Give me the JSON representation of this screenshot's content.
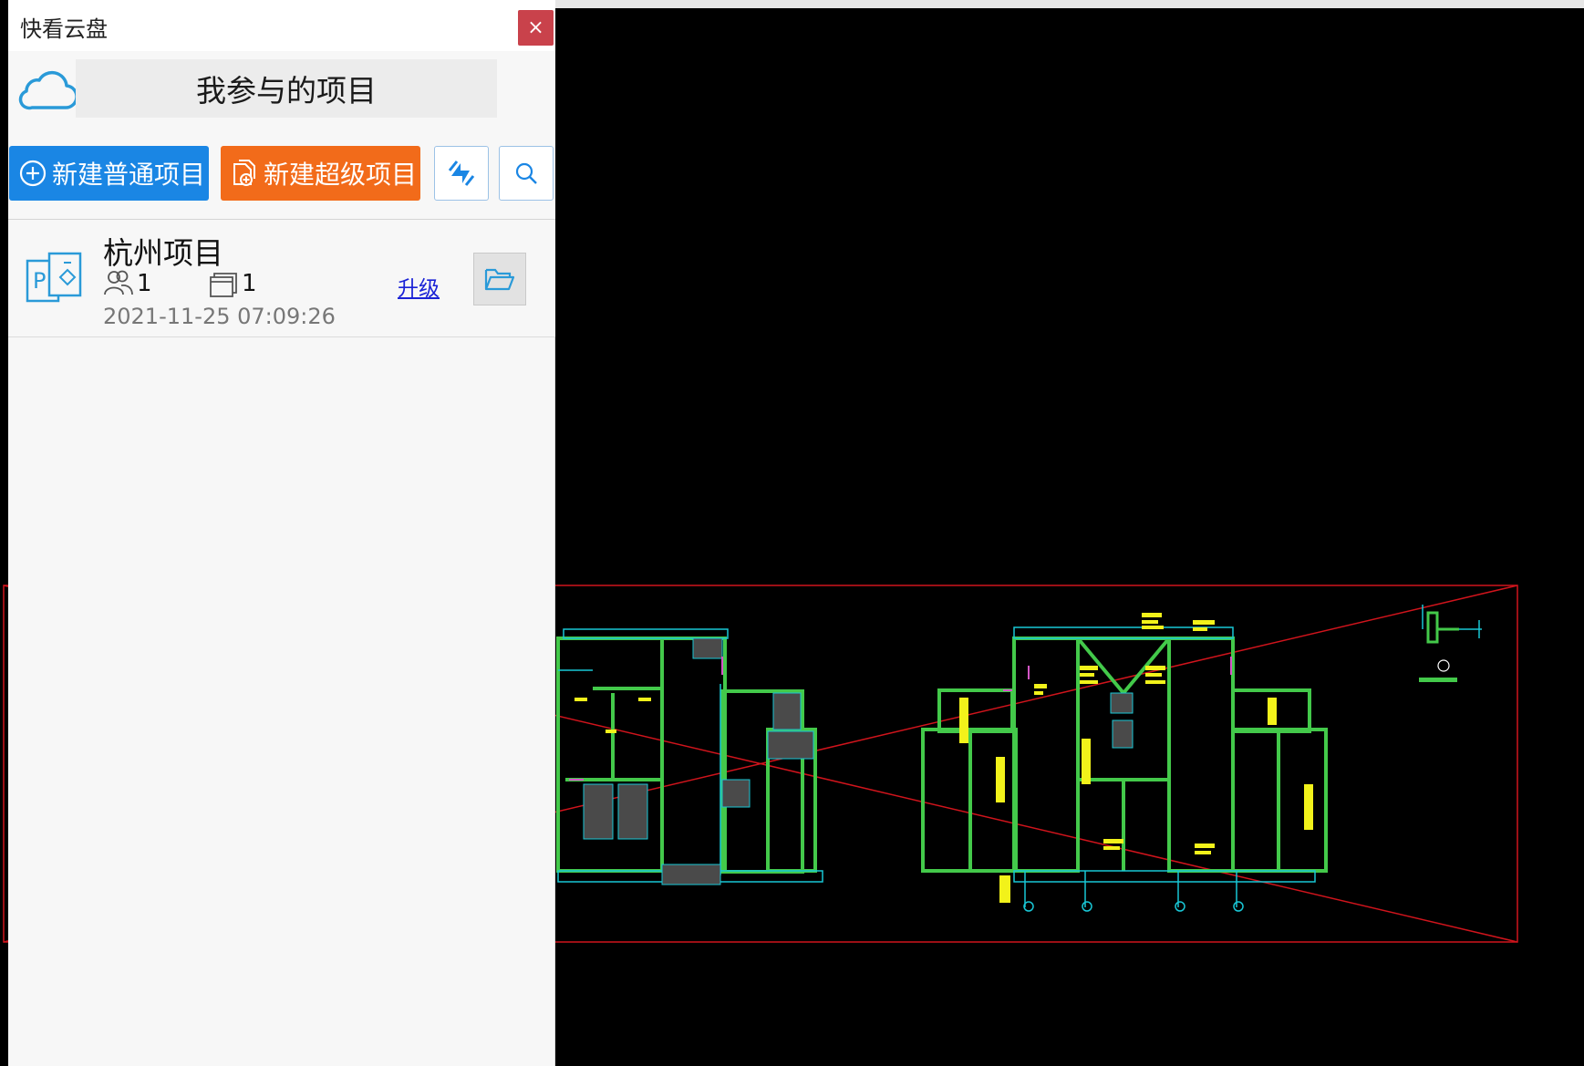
{
  "window": {
    "title": "快看云盘",
    "close_label": "×"
  },
  "header": {
    "logo_icon": "cloud-icon",
    "section_title": "我参与的项目"
  },
  "toolbar": {
    "new_normal_label": "新建普通项目",
    "new_super_label": "新建超级项目",
    "sync_icon": "sync-icon",
    "search_icon": "search-icon"
  },
  "projects": [
    {
      "name": "杭州项目",
      "members": "1",
      "files": "1",
      "date": "2021-11-25 07:09:26",
      "upgrade_label": "升级"
    }
  ],
  "colors": {
    "primary": "#1a86e4",
    "orange": "#f26b1a",
    "close": "#c9424b",
    "cad_bg": "#000000",
    "cad_frame": "#d0141c",
    "cad_walls": "#43c94a",
    "cad_text": "#f2f21a",
    "cad_dims": "#19c7d6"
  }
}
